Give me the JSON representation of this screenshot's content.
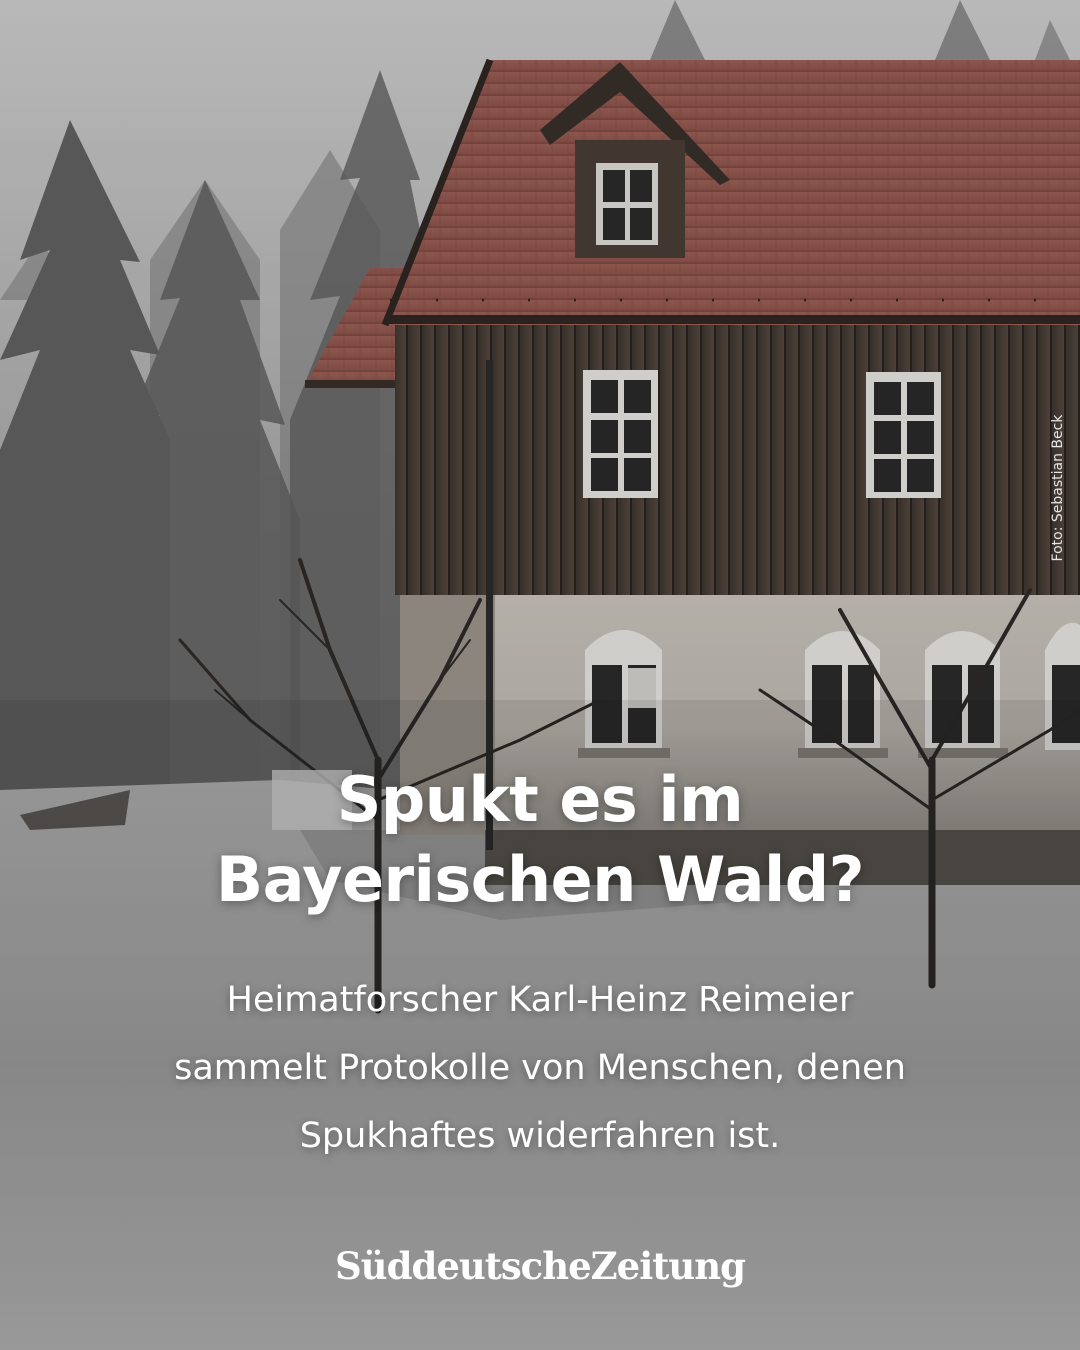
{
  "post": {
    "headline_lines": [
      "Spukt es im",
      "Bayerischen Wald?"
    ],
    "subline_lines": [
      "Heimatforscher Karl-Heinz Reimeier",
      "sammelt Protokolle von Menschen, denen",
      "Spukhaftes widerfahren ist."
    ],
    "brand": "SüddeutscheZeitung",
    "photo_credit": "Foto: Sebastian Beck"
  },
  "colors": {
    "text": "#ffffff",
    "roof": "#9a5a52",
    "wood": "#4a3f37",
    "plaster": "#cfcac2",
    "snow": "#b8b8b8",
    "fog": "#cfcfcf"
  }
}
